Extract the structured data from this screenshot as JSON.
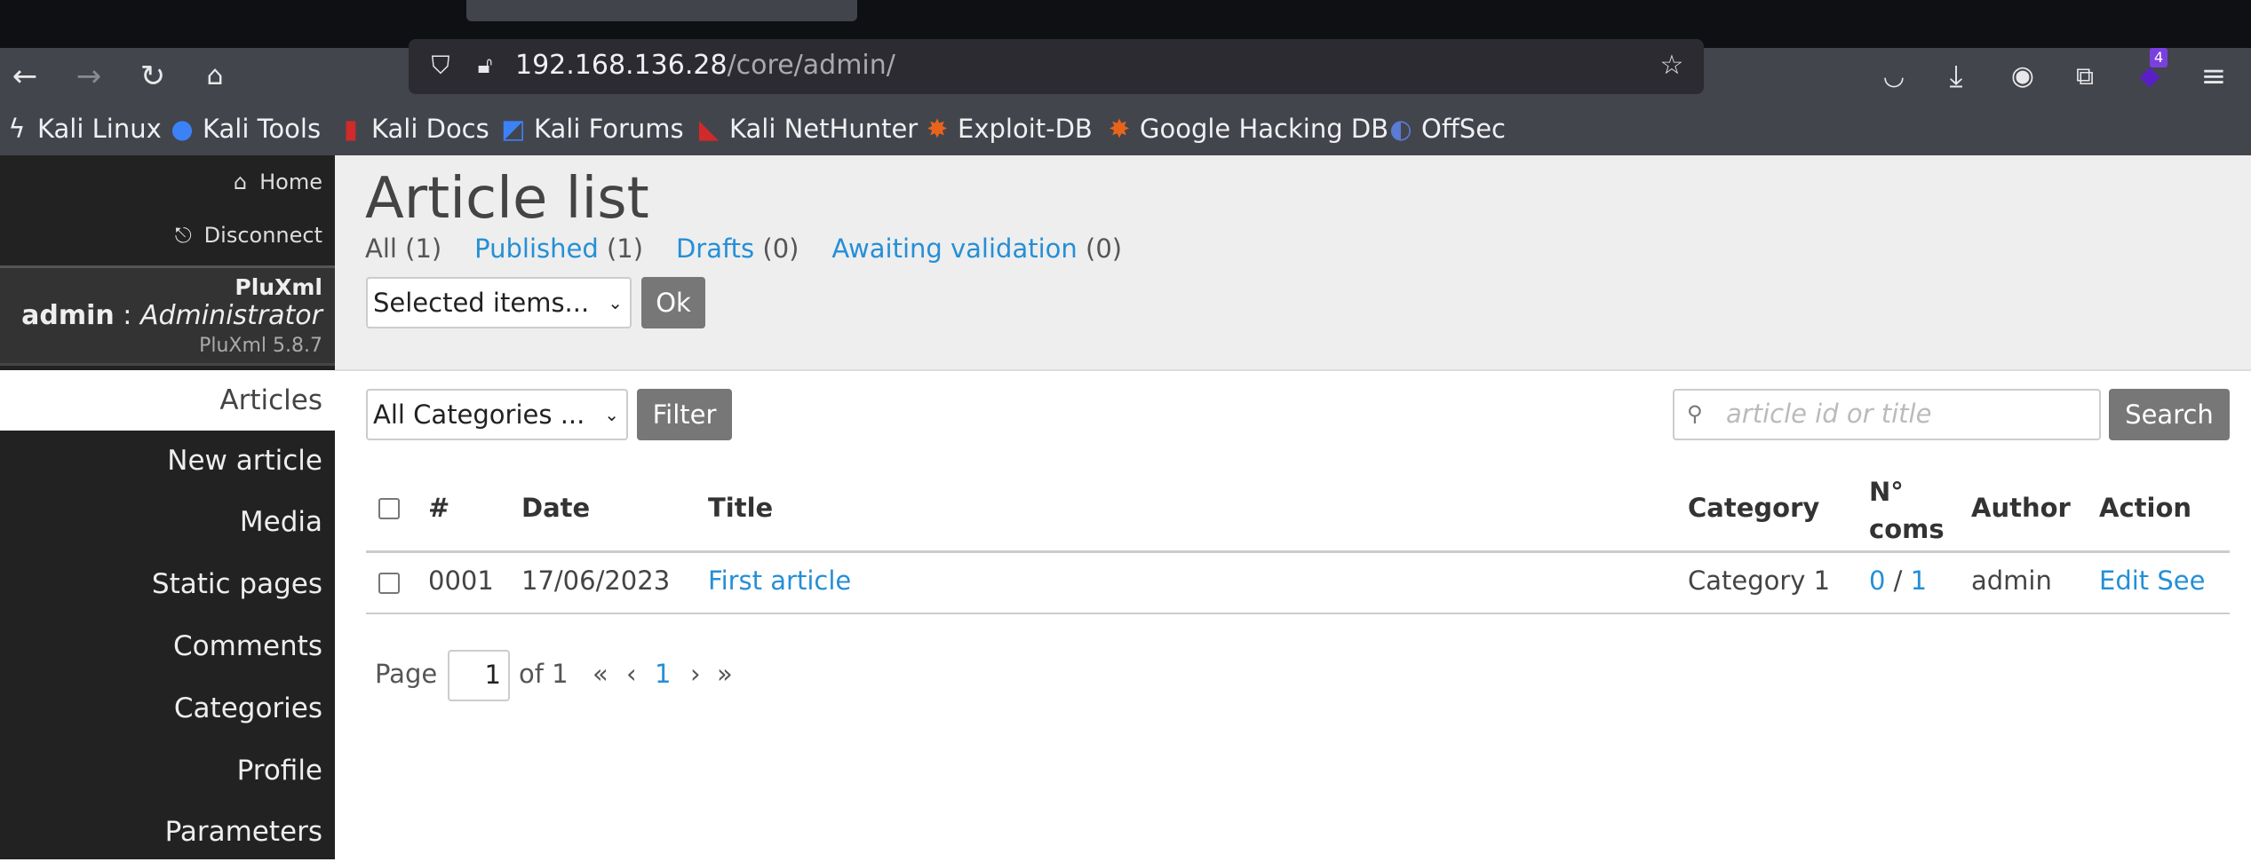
{
  "browser": {
    "url_host": "192.168.136.28",
    "url_path": "/core/admin/",
    "extension_badge": "4",
    "bookmarks": [
      {
        "label": "Kali Linux",
        "icon": "kali-dragon-icon"
      },
      {
        "label": "Kali Tools",
        "icon": "kali-tools-icon"
      },
      {
        "label": "Kali Docs",
        "icon": "kali-docs-icon"
      },
      {
        "label": "Kali Forums",
        "icon": "kali-forums-icon"
      },
      {
        "label": "Kali NetHunter",
        "icon": "nethunter-icon"
      },
      {
        "label": "Exploit-DB",
        "icon": "exploit-db-icon"
      },
      {
        "label": "Google Hacking DB",
        "icon": "ghdb-icon"
      },
      {
        "label": "OffSec",
        "icon": "offsec-icon"
      }
    ]
  },
  "sidebar": {
    "home": "Home",
    "disconnect": "Disconnect",
    "site_name": "PluXml",
    "user": "admin",
    "separator": " : ",
    "role": "Administrator",
    "version": "PluXml 5.8.7",
    "menu": [
      "Articles",
      "New article",
      "Media",
      "Static pages",
      "Comments",
      "Categories",
      "Profile",
      "Parameters"
    ]
  },
  "main": {
    "title": "Article list",
    "filters": [
      {
        "label": "All",
        "count": "(1)"
      },
      {
        "label": "Published",
        "count": "(1)"
      },
      {
        "label": "Drafts",
        "count": "(0)"
      },
      {
        "label": "Awaiting validation",
        "count": "(0)"
      }
    ],
    "bulk_select": "Selected items...",
    "ok": "Ok",
    "category_select": "All Categories ...",
    "filter": "Filter",
    "search_placeholder": "article id or title",
    "search": "Search",
    "columns": {
      "id": "#",
      "date": "Date",
      "title": "Title",
      "category": "Category",
      "coms1": "N°",
      "coms2": "coms",
      "author": "Author",
      "action": "Action"
    },
    "rows": [
      {
        "id": "0001",
        "date": "17/06/2023",
        "title": "First article",
        "category": "Category 1",
        "coms_new": "0",
        "coms_sep": " / ",
        "coms_total": "1",
        "author": "admin",
        "edit": "Edit",
        "see": "See"
      }
    ],
    "pagination": {
      "page_label": "Page",
      "page_value": "1",
      "of": "of 1",
      "first": "«",
      "prev": "‹",
      "current": "1",
      "next": "›",
      "last": "»"
    }
  }
}
